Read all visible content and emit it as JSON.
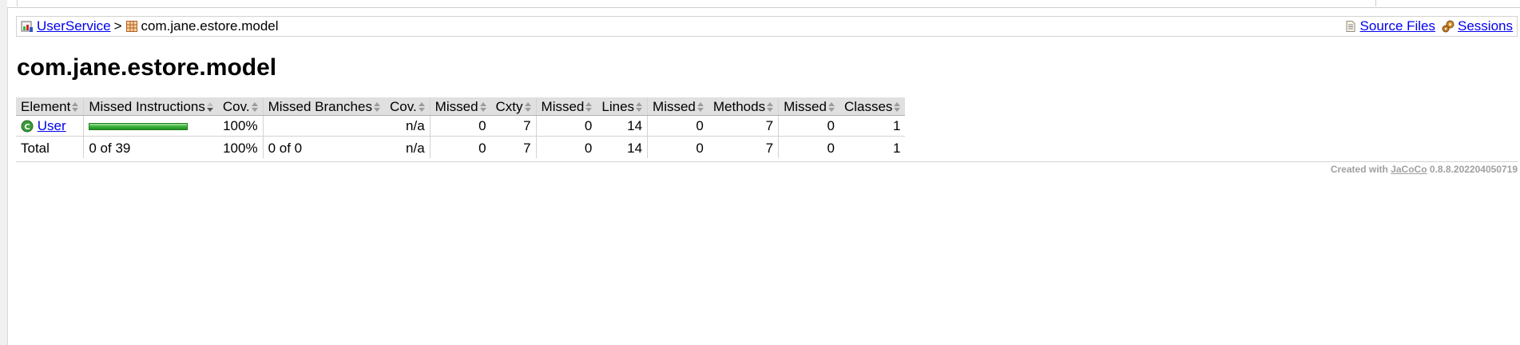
{
  "breadcrumb": {
    "root_label": "UserService",
    "separator": ">",
    "current_label": "com.jane.estore.model"
  },
  "info_links": {
    "source_files": "Source Files",
    "sessions": "Sessions"
  },
  "page_title": "com.jane.estore.model",
  "table": {
    "headers": {
      "element": "Element",
      "missed_instructions": "Missed Instructions",
      "cov1": "Cov.",
      "missed_branches": "Missed Branches",
      "cov2": "Cov.",
      "missed_cxty": "Missed",
      "cxty": "Cxty",
      "missed_lines": "Missed",
      "lines": "Lines",
      "missed_methods": "Missed",
      "methods": "Methods",
      "missed_classes": "Missed",
      "classes": "Classes"
    },
    "rows": [
      {
        "element": "User",
        "instruction_coverage_fraction": 1.0,
        "cov1": "100%",
        "missed_branches": "",
        "cov2": "n/a",
        "missed_cxty": "0",
        "cxty": "7",
        "missed_lines": "0",
        "lines": "14",
        "missed_methods": "0",
        "methods": "7",
        "missed_classes": "0",
        "classes": "1"
      }
    ],
    "total": {
      "label": "Total",
      "missed_instructions": "0 of 39",
      "cov1": "100%",
      "missed_branches": "0 of 0",
      "cov2": "n/a",
      "missed_cxty": "0",
      "cxty": "7",
      "missed_lines": "0",
      "lines": "14",
      "missed_methods": "0",
      "methods": "7",
      "missed_classes": "0",
      "classes": "1"
    }
  },
  "footer": {
    "prefix": "Created with",
    "link": "JaCoCo",
    "version": "0.8.8.202204050719"
  },
  "icons": {
    "report": "report-icon",
    "package": "package-icon",
    "source_files": "source-files-icon",
    "sessions": "sessions-icon",
    "class": "class-icon"
  },
  "colors": {
    "link": "#0000ee",
    "coverage_green": "#3fb53f",
    "header_bg": "#e0e0e0"
  }
}
